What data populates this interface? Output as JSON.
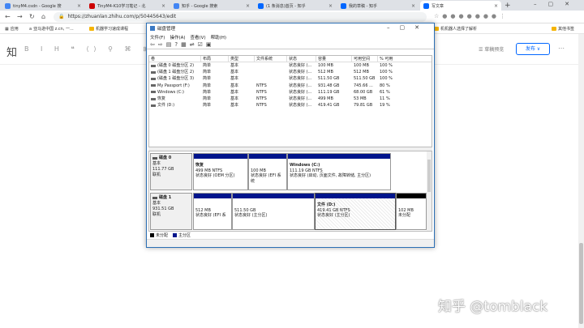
{
  "browser": {
    "tabs": [
      {
        "title": "tinyM4.csdn - Google 搜索",
        "color": "#4285f4"
      },
      {
        "title": "TinyM4-K10学习笔记 - 北...",
        "color": "#c00"
      },
      {
        "title": "知乎 - Google 搜索",
        "color": "#4285f4"
      },
      {
        "title": "(1 条消息)首页 - 知乎",
        "color": "#0066ff"
      },
      {
        "title": "我的草稿 - 知乎",
        "color": "#0066ff"
      },
      {
        "title": "写文章",
        "color": "#0066ff"
      }
    ],
    "url": "https://zhuanlan.zhihu.com/p/50445643/edit",
    "bookmarks": [
      {
        "label": "应用"
      },
      {
        "label": "亚马逊中国 z.cn, 一..."
      },
      {
        "label": "机器学习速成课程"
      },
      {
        "label": "机机器人选择了解析"
      },
      {
        "label": "其他书签"
      }
    ]
  },
  "zhihu": {
    "logo": "知",
    "preview": "☰ 草稿预览",
    "publish": "发布 ∨",
    "watermark": "知乎 @tomblack"
  },
  "window": {
    "title": "磁盘管理",
    "menu": [
      "文件(F)",
      "操作(A)",
      "查看(V)",
      "帮助(H)"
    ],
    "columns": [
      "卷",
      "布局",
      "类型",
      "文件系统",
      "状态",
      "容量",
      "可用空间",
      "% 可用"
    ],
    "volumes": [
      [
        "(磁盘 0 磁盘分区 2)",
        "简单",
        "基本",
        "",
        "状态良好 (...",
        "100 MB",
        "100 MB",
        "100 %"
      ],
      [
        "(磁盘 1 磁盘分区 2)",
        "简单",
        "基本",
        "",
        "状态良好 (...",
        "512 MB",
        "512 MB",
        "100 %"
      ],
      [
        "(磁盘 1 磁盘分区 3)",
        "简单",
        "基本",
        "",
        "状态良好 (...",
        "511.50 GB",
        "511.50 GB",
        "100 %"
      ],
      [
        "My Passport (F:)",
        "简单",
        "基本",
        "NTFS",
        "状态良好 (...",
        "931.48 GB",
        "745.66 ...",
        "80 %"
      ],
      [
        "Windows (C:)",
        "简单",
        "基本",
        "NTFS",
        "状态良好 (...",
        "111.19 GB",
        "68.00 GB",
        "61 %"
      ],
      [
        "恢复",
        "简单",
        "基本",
        "NTFS",
        "状态良好 (...",
        "499 MB",
        "53 MB",
        "11 %"
      ],
      [
        "文件 (D:)",
        "简单",
        "基本",
        "NTFS",
        "状态良好 (...",
        "419.41 GB",
        "79.81 GB",
        "19 %"
      ]
    ],
    "disks": [
      {
        "name": "磁盘 0",
        "type": "基本",
        "size": "111.77 GB",
        "status": "联机",
        "parts": [
          {
            "name": "恢复",
            "size": "499 MB NTFS",
            "status": "状态良好 (OEM 分区)",
            "bar": "#00158c"
          },
          {
            "name": "",
            "size": "100 MB",
            "status": "状态良好 (EFI 系统",
            "bar": "#00158c"
          },
          {
            "name": "Windows (C:)",
            "size": "111.19 GB NTFS",
            "status": "状态良好 (启动, 页面文件, 故障转储, 主分区)",
            "bar": "#00158c"
          }
        ]
      },
      {
        "name": "磁盘 1",
        "type": "基本",
        "size": "931.51 GB",
        "status": "联机",
        "parts": [
          {
            "name": "",
            "size": "512 MB",
            "status": "状态良好 (EFI 系",
            "bar": "#00158c"
          },
          {
            "name": "",
            "size": "511.50 GB",
            "status": "状态良好 (主分区)",
            "bar": "#00158c"
          },
          {
            "name": "文件 (D:)",
            "size": "419.41 GB NTFS",
            "status": "状态良好 (主分区)",
            "bar": "#00158c"
          },
          {
            "name": "",
            "size": "102 MB",
            "status": "未分配",
            "bar": "#000000"
          }
        ]
      }
    ],
    "legend": [
      {
        "label": "未分配",
        "color": "#000000"
      },
      {
        "label": "主分区",
        "color": "#00158c"
      }
    ]
  }
}
